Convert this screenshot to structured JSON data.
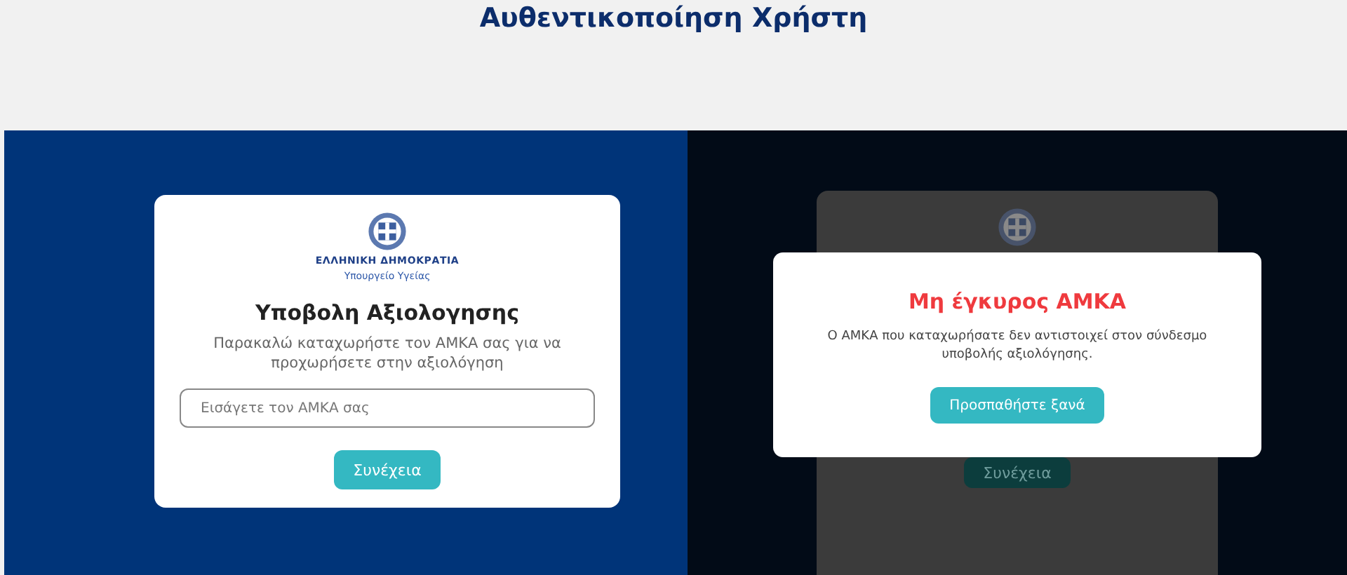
{
  "page_title": "Αυθεντικοποίηση Χρήστη",
  "form_card": {
    "org_name": "ΕΛΛΗΝΙΚΗ ΔΗΜΟΚΡΑΤΙΑ",
    "ministry": "Υπουργείο Υγείας",
    "title": "Υποβολη Αξιολογησης",
    "instructions": "Παρακαλώ καταχωρήστε τον ΑΜΚΑ σας για να προχωρήσετε στην αξιολόγηση",
    "amka_field": {
      "placeholder": "Εισάγετε τον ΑΜΚΑ σας"
    },
    "submit_button": "Συνέχεια"
  },
  "dimmed_card": {
    "submit_button": "Συνέχεια"
  },
  "error_dialog": {
    "title": "Μη έγκυρος ΑΜΚΑ",
    "message": "Ο ΑΜΚΑ που καταχωρήσατε δεν αντιστοιχεί στον σύνδεσμο υποβολής αξιολόγησης.",
    "retry_button": "Προσπαθήστε ξανά"
  }
}
